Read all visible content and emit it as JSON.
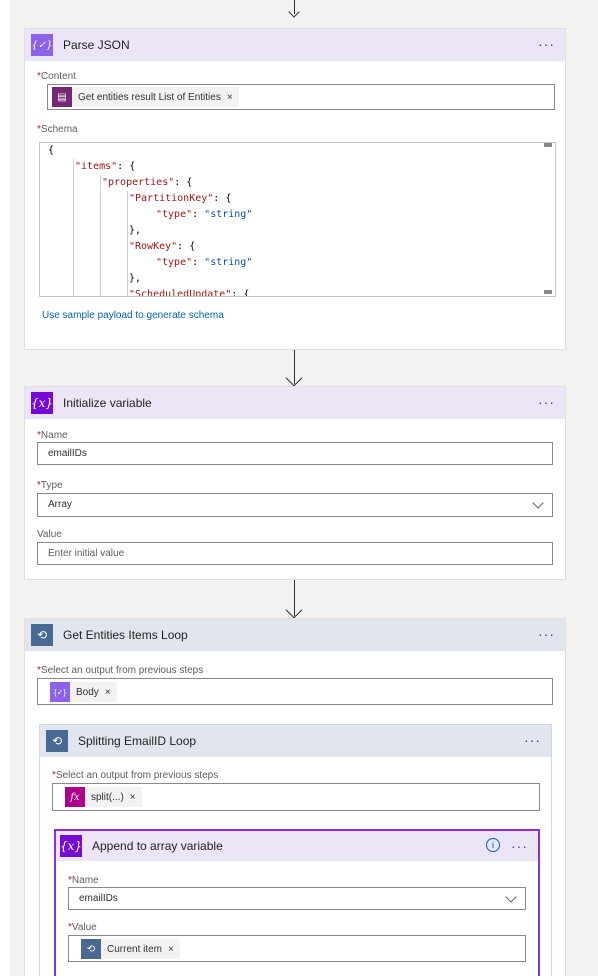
{
  "parse_json": {
    "title": "Parse JSON",
    "more": "···",
    "content_label": "Content",
    "content_chip": "Get entities result List of Entities",
    "schema_label": "Schema",
    "schema_lines": [
      {
        "indent": 0,
        "parts": [
          {
            "t": "{",
            "c": ""
          }
        ]
      },
      {
        "indent": 1,
        "parts": [
          {
            "t": "\"items\"",
            "c": "k"
          },
          {
            "t": ": {",
            "c": ""
          }
        ]
      },
      {
        "indent": 2,
        "parts": [
          {
            "t": "\"properties\"",
            "c": "k"
          },
          {
            "t": ": {",
            "c": ""
          }
        ]
      },
      {
        "indent": 3,
        "parts": [
          {
            "t": "\"PartitionKey\"",
            "c": "k"
          },
          {
            "t": ": {",
            "c": ""
          }
        ]
      },
      {
        "indent": 4,
        "parts": [
          {
            "t": "\"type\"",
            "c": "k"
          },
          {
            "t": ": ",
            "c": ""
          },
          {
            "t": "\"string\"",
            "c": "s"
          }
        ]
      },
      {
        "indent": 3,
        "parts": [
          {
            "t": "},",
            "c": ""
          }
        ]
      },
      {
        "indent": 3,
        "parts": [
          {
            "t": "\"RowKey\"",
            "c": "k"
          },
          {
            "t": ": {",
            "c": ""
          }
        ]
      },
      {
        "indent": 4,
        "parts": [
          {
            "t": "\"type\"",
            "c": "k"
          },
          {
            "t": ": ",
            "c": ""
          },
          {
            "t": "\"string\"",
            "c": "s"
          }
        ]
      },
      {
        "indent": 3,
        "parts": [
          {
            "t": "},",
            "c": ""
          }
        ]
      },
      {
        "indent": 3,
        "parts": [
          {
            "t": "\"ScheduledUpdate\"",
            "c": "k"
          },
          {
            "t": ": {",
            "c": ""
          }
        ]
      }
    ],
    "sample_link": "Use sample payload to generate schema"
  },
  "init_variable": {
    "title": "Initialize variable",
    "more": "···",
    "name_label": "Name",
    "name_value": "emailIDs",
    "type_label": "Type",
    "type_value": "Array",
    "value_label": "Value",
    "value_placeholder": "Enter initial value"
  },
  "loop_outer": {
    "title": "Get Entities Items Loop",
    "more": "···",
    "select_label": "Select an output from previous steps",
    "chip": "Body"
  },
  "loop_inner": {
    "title": "Splitting EmailID Loop",
    "more": "···",
    "select_label": "Select an output from previous steps",
    "chip": "split(...)"
  },
  "append": {
    "title": "Append to array variable",
    "more": "···",
    "name_label": "Name",
    "name_value": "emailIDs",
    "value_label": "Value",
    "chip": "Current item"
  },
  "colors": {
    "purple_header": "#ece5f7",
    "purple_icon": "#770bd6",
    "loop_header": "#e1e6ee",
    "loop_icon": "#486991",
    "fx_icon": "#ad008c",
    "selected_border": "#8c2ed9"
  }
}
